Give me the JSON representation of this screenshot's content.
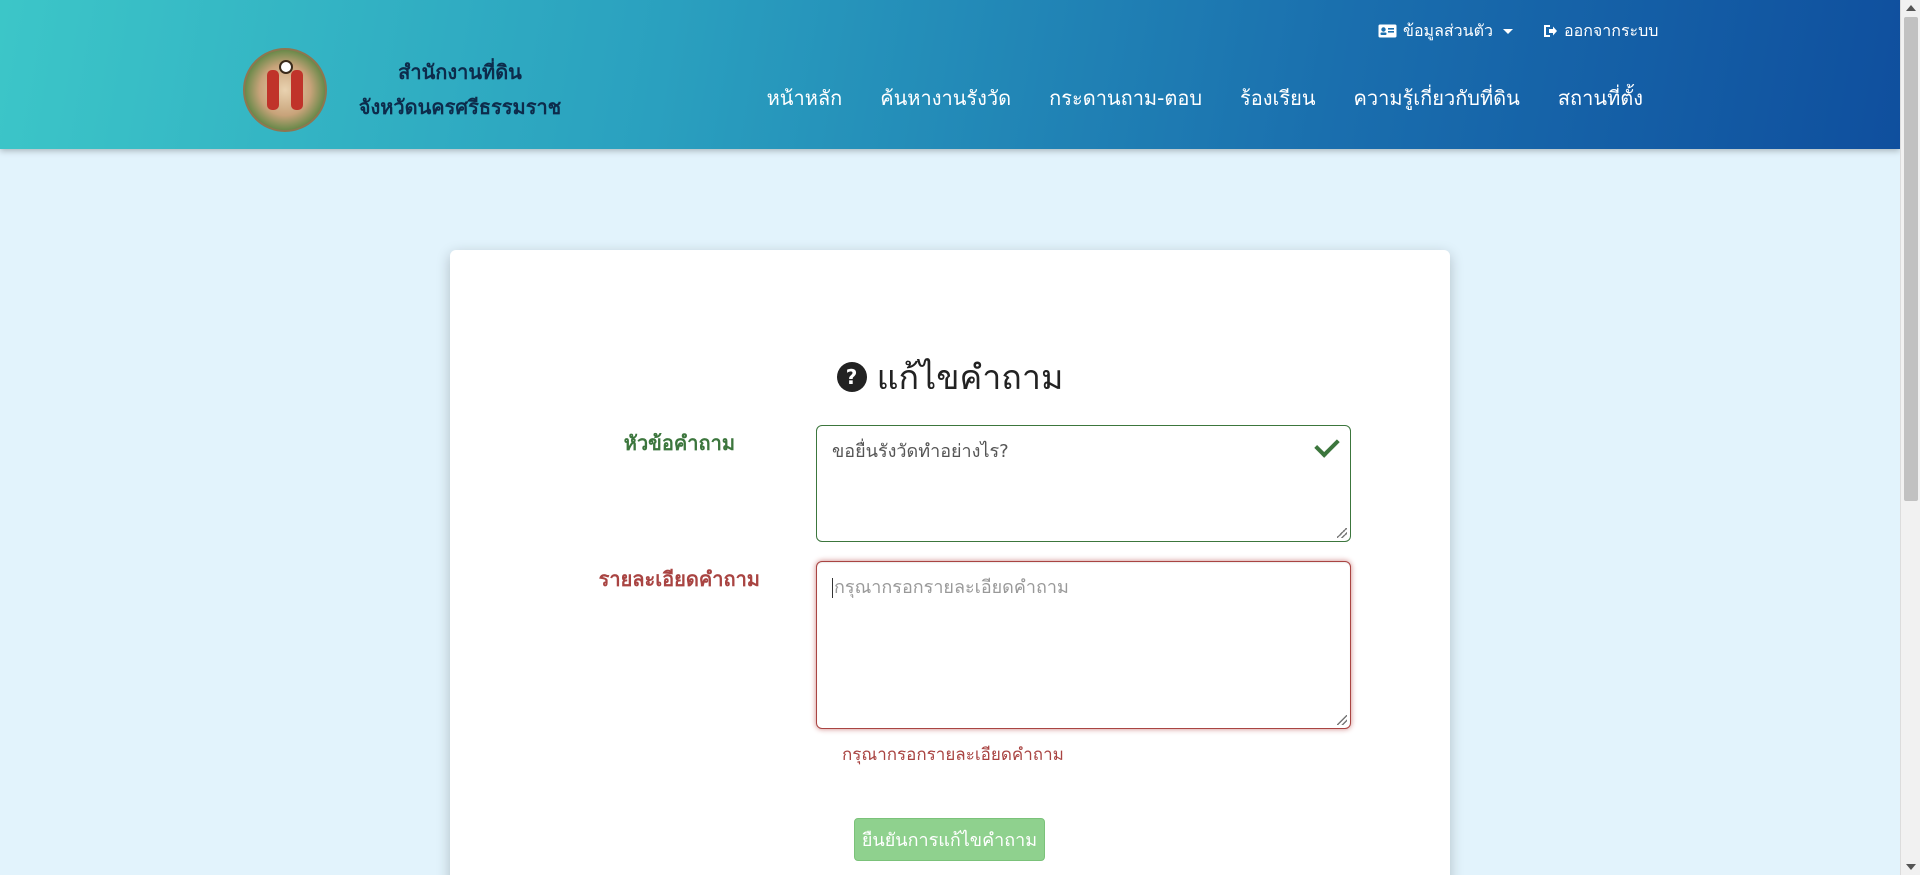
{
  "header": {
    "brand_line1": "สำนักงานที่ดิน",
    "brand_line2": "จังหวัดนครศรีธรรมราช",
    "profile_label": "ข้อมูลส่วนตัว",
    "logout_label": "ออกจากระบบ",
    "nav": [
      {
        "label": "หน้าหลัก"
      },
      {
        "label": "ค้นหางานรังวัด"
      },
      {
        "label": "กระดานถาม-ตอบ"
      },
      {
        "label": "ร้องเรียน"
      },
      {
        "label": "ความรู้เกี่ยวกับที่ดิน"
      },
      {
        "label": "สถานที่ตั้ง"
      }
    ]
  },
  "form": {
    "title": "แก้ไขคำถาม",
    "subject_label": "หัวข้อคำถาม",
    "subject_value": "ขอยื่นรังวัดทำอย่างไร?",
    "detail_label": "รายละเอียดคำถาม",
    "detail_placeholder": "กรุณากรอกรายละเอียดคำถาม",
    "detail_error": "กรุณากรอกรายละเอียดคำถาม",
    "submit_label": "ยืนยันการแก้ไขคำถาม"
  },
  "colors": {
    "success": "#3c763d",
    "error": "#a94442",
    "button": "#8fd18e"
  }
}
